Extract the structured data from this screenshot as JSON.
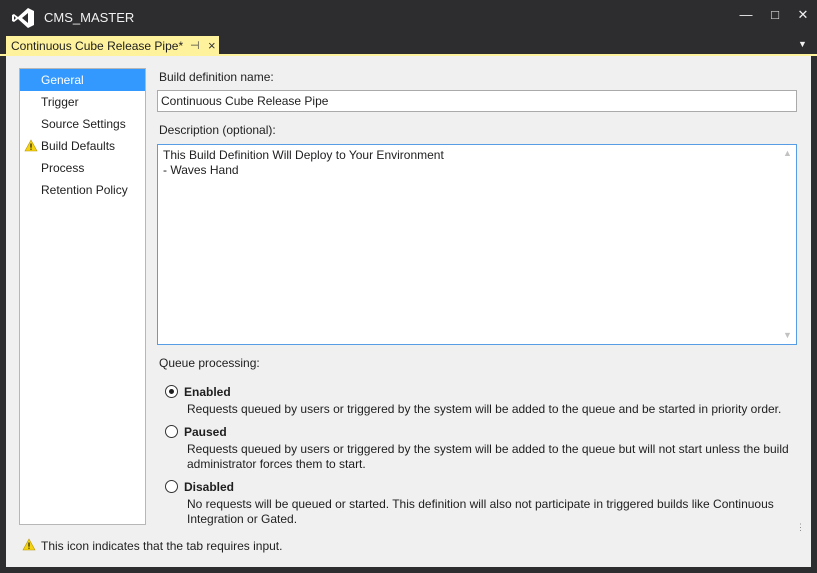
{
  "window": {
    "title": "CMS_MASTER",
    "min_glyph": "—",
    "max_glyph": "□",
    "close_glyph": "✕"
  },
  "tab": {
    "label": "Continuous Cube Release Pipe*",
    "pin_glyph": "⊣",
    "close_glyph": "×",
    "dropdown_glyph": "▼",
    "accent_color": "#fff29d"
  },
  "nav": {
    "items": [
      {
        "label": "General",
        "selected": true,
        "warning": false
      },
      {
        "label": "Trigger",
        "selected": false,
        "warning": false
      },
      {
        "label": "Source Settings",
        "selected": false,
        "warning": false
      },
      {
        "label": "Build Defaults",
        "selected": false,
        "warning": true
      },
      {
        "label": "Process",
        "selected": false,
        "warning": false
      },
      {
        "label": "Retention Policy",
        "selected": false,
        "warning": false
      }
    ],
    "selected_color": "#3399ff"
  },
  "form": {
    "name_label": "Build definition name:",
    "name_value": "Continuous Cube Release Pipe",
    "description_label": "Description (optional):",
    "description_value": "This Build Definition Will Deploy to Your Environment\n- Waves Hand",
    "queue_label": "Queue processing:",
    "queue_options": [
      {
        "title": "Enabled",
        "checked": true,
        "desc": "Requests queued by users or triggered by the system will be added to the queue and be started in priority order."
      },
      {
        "title": "Paused",
        "checked": false,
        "desc": "Requests queued by users or triggered by the system will be added to the queue but will not start unless the build administrator forces them to start."
      },
      {
        "title": "Disabled",
        "checked": false,
        "desc": "No requests will be queued or started. This definition will also not participate in triggered builds like Continuous Integration or Gated."
      }
    ]
  },
  "footer": {
    "note": "This icon indicates that the tab requires input.",
    "icon": "warning-icon"
  }
}
